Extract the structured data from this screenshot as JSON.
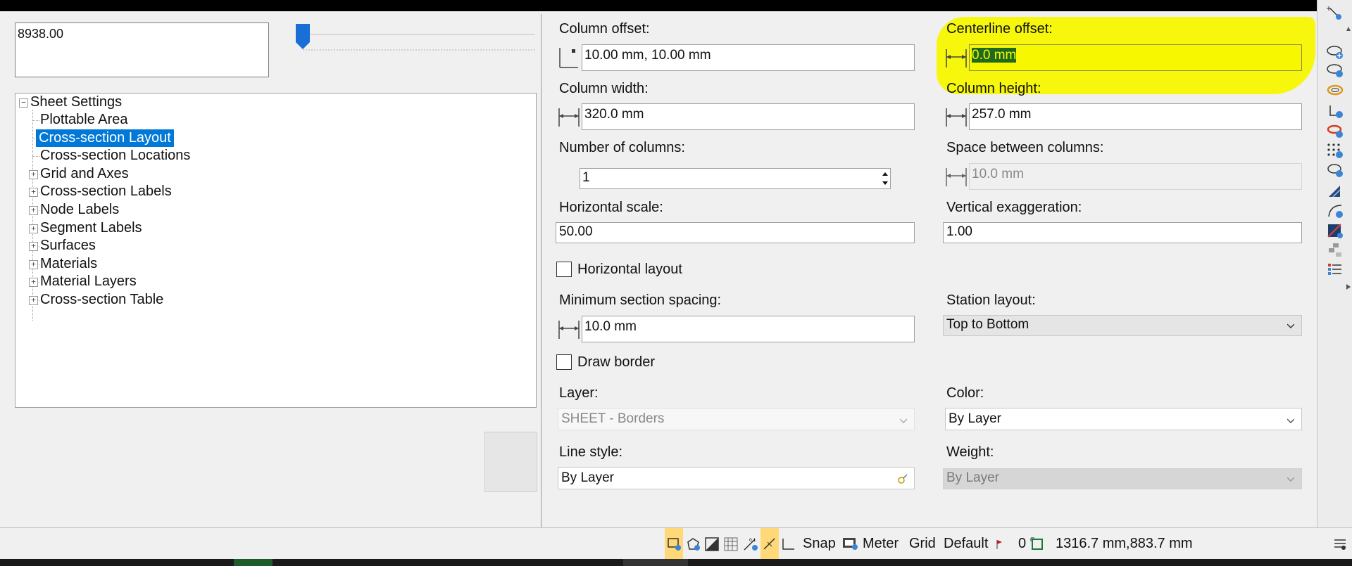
{
  "left": {
    "value_box": "8938.00",
    "tree": {
      "root": "Sheet Settings",
      "items": [
        {
          "label": "Plottable Area",
          "expandable": false,
          "selected": false
        },
        {
          "label": "Cross-section Layout",
          "expandable": false,
          "selected": true
        },
        {
          "label": "Cross-section Locations",
          "expandable": false,
          "selected": false
        },
        {
          "label": "Grid and Axes",
          "expandable": true,
          "selected": false
        },
        {
          "label": "Cross-section Labels",
          "expandable": true,
          "selected": false
        },
        {
          "label": "Node Labels",
          "expandable": true,
          "selected": false
        },
        {
          "label": "Segment Labels",
          "expandable": true,
          "selected": false
        },
        {
          "label": "Surfaces",
          "expandable": true,
          "selected": false
        },
        {
          "label": "Materials",
          "expandable": true,
          "selected": false
        },
        {
          "label": "Material Layers",
          "expandable": true,
          "selected": false
        },
        {
          "label": "Cross-section Table",
          "expandable": true,
          "selected": false
        }
      ]
    }
  },
  "form": {
    "column_offset": {
      "label": "Column offset:",
      "value": "10.00 mm, 10.00 mm"
    },
    "centerline_offset": {
      "label": "Centerline offset:",
      "value": "0.0 mm"
    },
    "column_width": {
      "label": "Column width:",
      "value": "320.0 mm"
    },
    "column_height": {
      "label": "Column height:",
      "value": "257.0 mm"
    },
    "number_of_columns": {
      "label": "Number of columns:",
      "value": "1"
    },
    "space_between_columns": {
      "label": "Space between columns:",
      "value": "10.0 mm"
    },
    "horizontal_scale": {
      "label": "Horizontal scale:",
      "value": "50.00"
    },
    "vertical_exaggeration": {
      "label": "Vertical exaggeration:",
      "value": "1.00"
    },
    "horizontal_layout": {
      "label": "Horizontal layout",
      "checked": false
    },
    "minimum_section_spacing": {
      "label": "Minimum section spacing:",
      "value": "10.0 mm"
    },
    "station_layout": {
      "label": "Station layout:",
      "value": "Top to Bottom"
    },
    "draw_border": {
      "label": "Draw border",
      "checked": false
    },
    "layer": {
      "label": "Layer:",
      "value": "SHEET - Borders"
    },
    "color": {
      "label": "Color:",
      "value": "By Layer"
    },
    "line_style": {
      "label": "Line style:",
      "value": "By Layer"
    },
    "weight": {
      "label": "Weight:",
      "value": "By Layer"
    }
  },
  "statusbar": {
    "snap": "Snap",
    "meter": "Meter",
    "grid": "Grid",
    "default": "Default",
    "count": "0",
    "coords": "1316.7 mm,883.7 mm"
  },
  "colors": {
    "selection": "#0078d7",
    "highlight": "#f7f700",
    "accent_blue": "#1a6fd6",
    "status_toggle": "#ffd978"
  },
  "icons": {
    "sidebar": [
      "select-nodes-icon",
      "cloud-add-icon",
      "cloud-edit-icon",
      "ring-icon",
      "axis-add-icon",
      "ring-add-icon",
      "grid-points-icon",
      "ellipse-add-icon",
      "triangle-icon",
      "arc-add-icon",
      "gradient-icon",
      "stack-icon",
      "list-icon"
    ]
  }
}
